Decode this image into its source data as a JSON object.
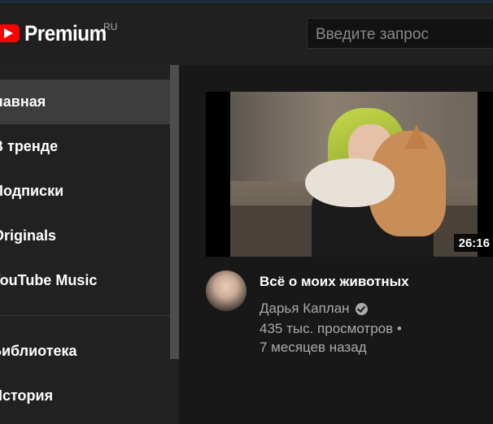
{
  "header": {
    "logo_text": "Premium",
    "region": "RU",
    "search_placeholder": "Введите запрос"
  },
  "sidebar": {
    "items": [
      {
        "label": "Главная",
        "active": true
      },
      {
        "label": "В тренде",
        "active": false
      },
      {
        "label": "Подписки",
        "active": false
      },
      {
        "label": "Originals",
        "active": false
      },
      {
        "label": "YouTube Music",
        "active": false
      },
      {
        "label": "Библиотека",
        "active": false
      },
      {
        "label": "История",
        "active": false
      }
    ]
  },
  "video": {
    "title": "Всё о моих животных",
    "channel": "Дарья Каплан",
    "views": "435 тыс. просмотров •",
    "age": "7 месяцев назад",
    "duration": "26:16"
  },
  "colors": {
    "brand_red": "#ff0000",
    "background": "#181818",
    "sidebar_bg": "#212121",
    "active_item": "#3d3d3d"
  }
}
